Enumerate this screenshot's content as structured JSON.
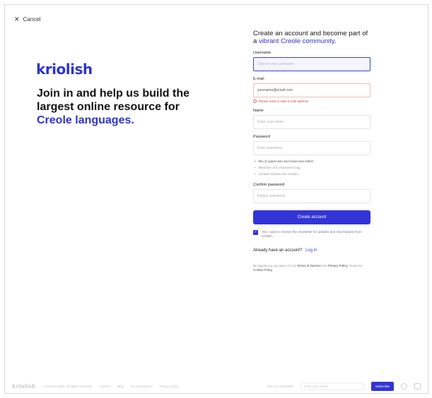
{
  "nav": {
    "cancel_label": "Cancel",
    "cancel_icon": "close-icon"
  },
  "brand": {
    "logo": "kriolish",
    "color": "#2f34c9"
  },
  "hero": {
    "headline": "Join in and help us build the largest online resource for",
    "headline_accent": "Creole languages."
  },
  "form": {
    "title": "Create an account and become part of a",
    "title_accent": "vibrant Creole community.",
    "username": {
      "label": "Username",
      "placeholder": "Choose your username"
    },
    "email": {
      "label": "E-mail",
      "value": "yourname@email.com",
      "error": "Please enter a valid e-mail address"
    },
    "name": {
      "label": "Name",
      "placeholder": "Enter your name"
    },
    "password": {
      "label": "Password",
      "placeholder": "Enter password",
      "rules": [
        "Mix of uppercase and lowercase letters",
        "Minimum of 8 characters long",
        "Contain at least one number"
      ]
    },
    "confirm": {
      "label": "Confirm password",
      "placeholder": "Retype password"
    },
    "submit_label": "Create account",
    "consent_text": "Yes, I want to receive the newsletter for updates and new features from Kriolish.",
    "have_account": "Already have an account?",
    "login_label": "Log in",
    "legal_text": "By signing up you agree to our",
    "legal_terms": "Terms of Service",
    "legal_and": "and",
    "legal_privacy": "Privacy Policy",
    "legal_suffix": ". Read our",
    "legal_cookies": "Cookie Policy",
    "accent": "#3235d6"
  },
  "footer": {
    "logo": "kriolish",
    "copyright": "© 2023 Kriolish. All rights reserved.",
    "links": [
      "Contact",
      "Blog",
      "For Developers",
      "Privacy policy"
    ],
    "newsletter_label": "Join our newsletter",
    "email_placeholder": "Enter your email",
    "subscribe_label": "Subscribe"
  }
}
